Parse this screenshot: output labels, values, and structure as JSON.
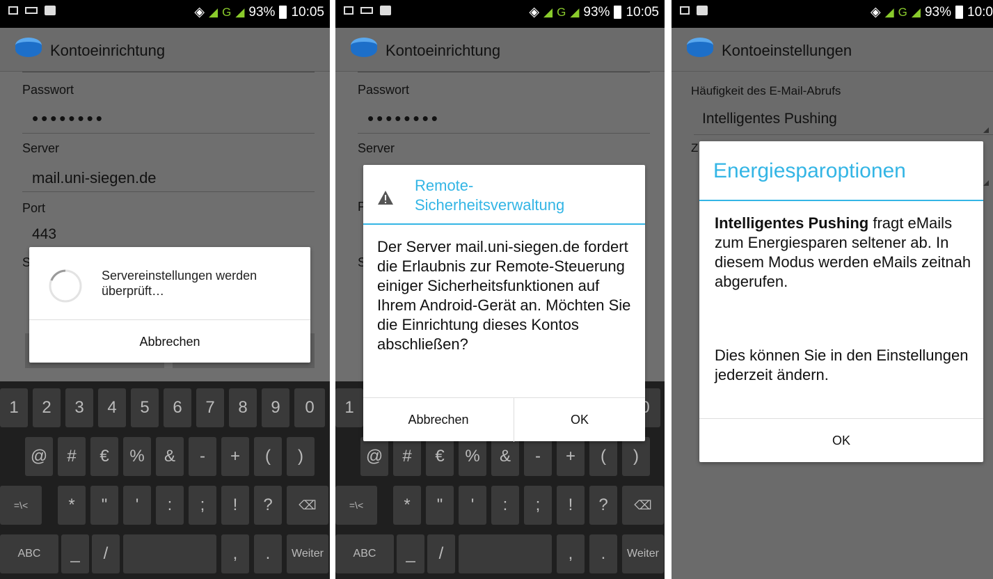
{
  "status": {
    "battery": "93%",
    "time": "10:05",
    "time_cut": "10:0",
    "network": "G"
  },
  "panel1": {
    "title": "Kontoeinrichtung",
    "password_label": "Passwort",
    "password_value": "••••••••",
    "server_label": "Server",
    "server_value": "mail.uni-siegen.de",
    "port_label": "Port",
    "port_value": "443",
    "partial_s": "S",
    "dialog_message": "Servereinstellungen werden überprüft…",
    "cancel": "Abbrechen"
  },
  "panel2": {
    "title": "Kontoeinrichtung",
    "password_label": "Passwort",
    "password_value": "••••••••",
    "server_label": "Server",
    "partial_p": "P",
    "partial_s": "S",
    "partial_one": "1",
    "partial_zero": "0",
    "dialog_title_1": "Remote-",
    "dialog_title_2": "Sicherheitsverwaltung",
    "dialog_body": "Der Server mail.uni-siegen.de fordert die Erlaubnis zur Remote-Steuerung einiger Sicherheitsfunktionen auf Ihrem Android-Gerät an. Möchten Sie die Einrichtung dieses Kontos abschließen?",
    "cancel": "Abbrechen",
    "ok": "OK"
  },
  "panel3": {
    "title": "Kontoeinstellungen",
    "freq_label": "Häufigkeit des E-Mail-Abrufs",
    "freq_value": "Intelligentes Pushing",
    "partial_z": "Z",
    "dialog_title": "Energiesparoptionen",
    "dialog_bold": "Intelligentes Pushing",
    "dialog_text1": " fragt eMails zum Energiesparen seltener ab. In diesem Modus werden eMails zeitnah abgerufen.",
    "dialog_text2": "Dies können Sie in den Einstellungen jederzeit ändern.",
    "ok": "OK"
  },
  "keyboard": {
    "row1": [
      "1",
      "2",
      "3",
      "4",
      "5",
      "6",
      "7",
      "8",
      "9",
      "0"
    ],
    "row2": [
      "@",
      "#",
      "€",
      "%",
      "&",
      "-",
      "+",
      "(",
      ")"
    ],
    "row3": [
      "=\\<",
      "*",
      "\"",
      "'",
      ":",
      ";",
      "!",
      "?"
    ],
    "abc": "ABC",
    "underscore": "_",
    "slash": "/",
    "comma": ",",
    "dot": ".",
    "weiter": "Weiter",
    "delete_icon": "backspace-icon"
  },
  "colors": {
    "accent": "#33b5e5",
    "signal": "#8acb2c"
  }
}
